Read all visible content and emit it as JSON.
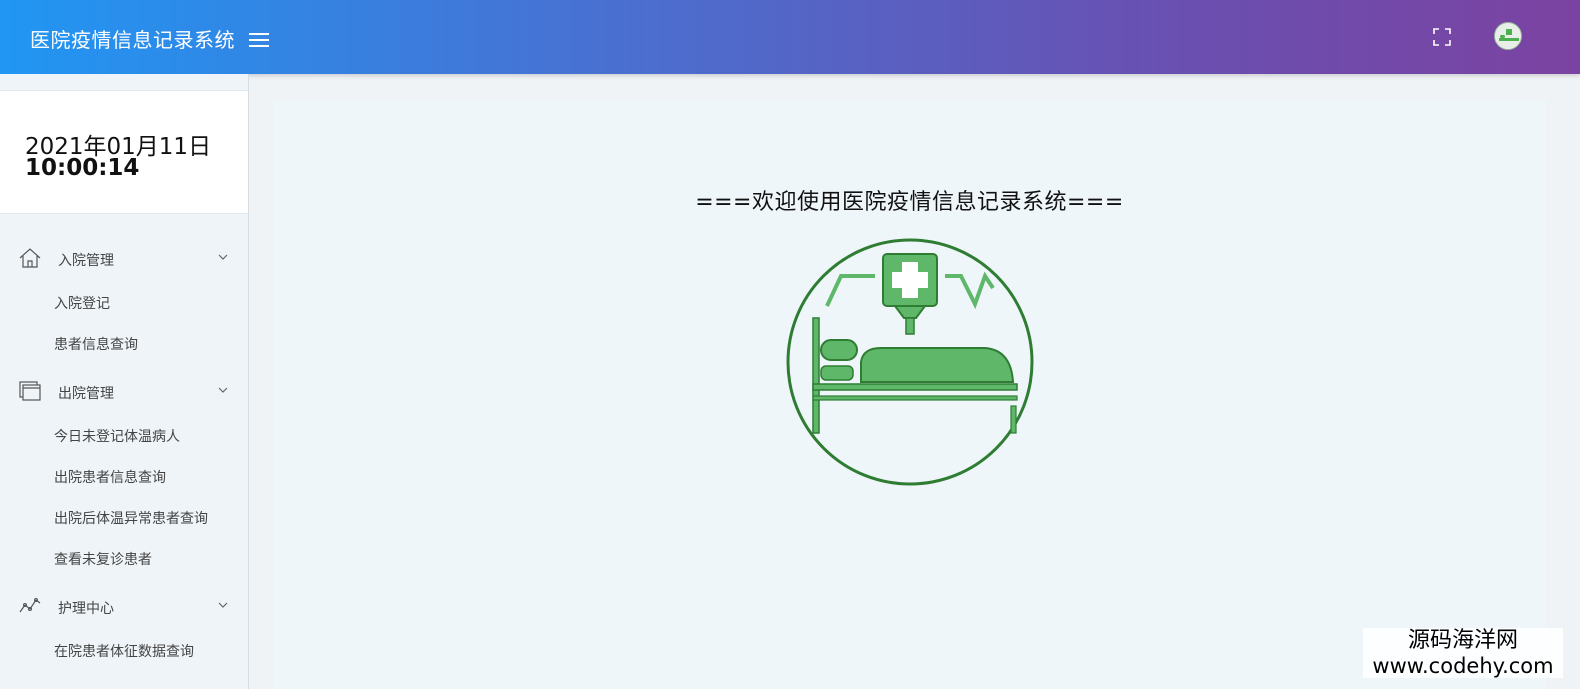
{
  "header": {
    "title": "医院疫情信息记录系统",
    "menu_icon": "hamburger-icon",
    "fullscreen_icon": "fullscreen-icon",
    "avatar_icon": "avatar-icon"
  },
  "clock": {
    "date": "2021年01月11日",
    "time": "10:00:14"
  },
  "sidebar": {
    "groups": [
      {
        "label": "入院管理",
        "icon": "home-icon",
        "items": [
          "入院登记",
          "患者信息查询"
        ]
      },
      {
        "label": "出院管理",
        "icon": "windows-icon",
        "items": [
          "今日未登记体温病人",
          "出院患者信息查询",
          "出院后体温异常患者查询",
          "查看未复诊患者"
        ]
      },
      {
        "label": "护理中心",
        "icon": "chart-line-icon",
        "items": [
          "在院患者体征数据查询"
        ]
      }
    ]
  },
  "main": {
    "welcome": "===欢迎使用医院疫情信息记录系统==="
  },
  "watermark": {
    "name": "源码海洋网",
    "url": "www.codehy.com"
  },
  "colors": {
    "header_start": "#2196f3",
    "header_end": "#7b43a1",
    "logo_green": "#5fb86a",
    "logo_outline": "#2e7d32"
  }
}
